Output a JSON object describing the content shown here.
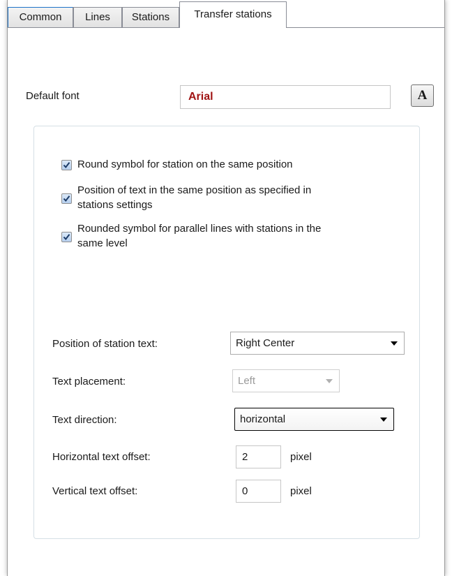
{
  "tabs": [
    {
      "label": "Common",
      "active": false
    },
    {
      "label": "Lines",
      "active": false
    },
    {
      "label": "Stations",
      "active": false
    },
    {
      "label": "Transfer stations",
      "active": true
    }
  ],
  "default_font": {
    "label": "Default font",
    "value": "Arial",
    "button_label": "A"
  },
  "options": [
    {
      "label": "Round symbol for station on the same position",
      "checked": true
    },
    {
      "label_line1": "Position of text in the same position as specified in",
      "label_line2": "stations settings",
      "checked": true
    },
    {
      "label_line1": "Rounded symbol for parallel lines with stations in the",
      "label_line2": "same level",
      "checked": true
    }
  ],
  "fields": {
    "station_text_position": {
      "label": "Position of station text:",
      "value": "Right Center"
    },
    "text_placement": {
      "label": "Text placement:",
      "value": "Left",
      "enabled": false
    },
    "text_direction": {
      "label": "Text direction:",
      "value": "horizontal"
    },
    "horizontal_offset": {
      "label": "Horizontal text offset:",
      "value": "2",
      "unit": "pixel"
    },
    "vertical_offset": {
      "label": "Vertical text offset:",
      "value": "0",
      "unit": "pixel"
    }
  },
  "colors": {
    "font_value": "#a01414",
    "tab_border": "#898c95",
    "checkbox_fill": "#b6cfee"
  }
}
